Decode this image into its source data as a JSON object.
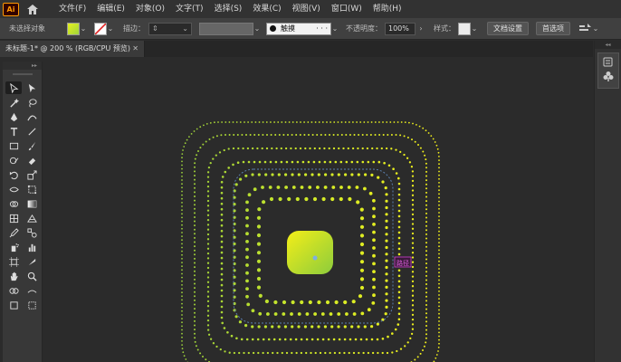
{
  "app": {
    "logo": "Ai"
  },
  "menu": [
    {
      "label": "文件(F)"
    },
    {
      "label": "编辑(E)"
    },
    {
      "label": "对象(O)"
    },
    {
      "label": "文字(T)"
    },
    {
      "label": "选择(S)"
    },
    {
      "label": "效果(C)"
    },
    {
      "label": "视图(V)"
    },
    {
      "label": "窗口(W)"
    },
    {
      "label": "帮助(H)"
    }
  ],
  "control": {
    "selection_label": "未选择对象",
    "stroke_label": "描边：",
    "brush_label": "触摸",
    "opacity_label": "不透明度：",
    "opacity_value": "100%",
    "style_label": "样式：",
    "doc_setup": "文档设置",
    "preferences": "首选项",
    "fill_color": "#c8e830",
    "accent": "#ff9a00"
  },
  "document": {
    "tab_title": "未标题-1* @ 200 % (RGB/CPU 预览)",
    "close_glyph": "✕"
  },
  "panels": {
    "collapse_glyph": "◂◂",
    "expand_glyph": "▸▸"
  },
  "canvas": {
    "annotation": "路径"
  }
}
